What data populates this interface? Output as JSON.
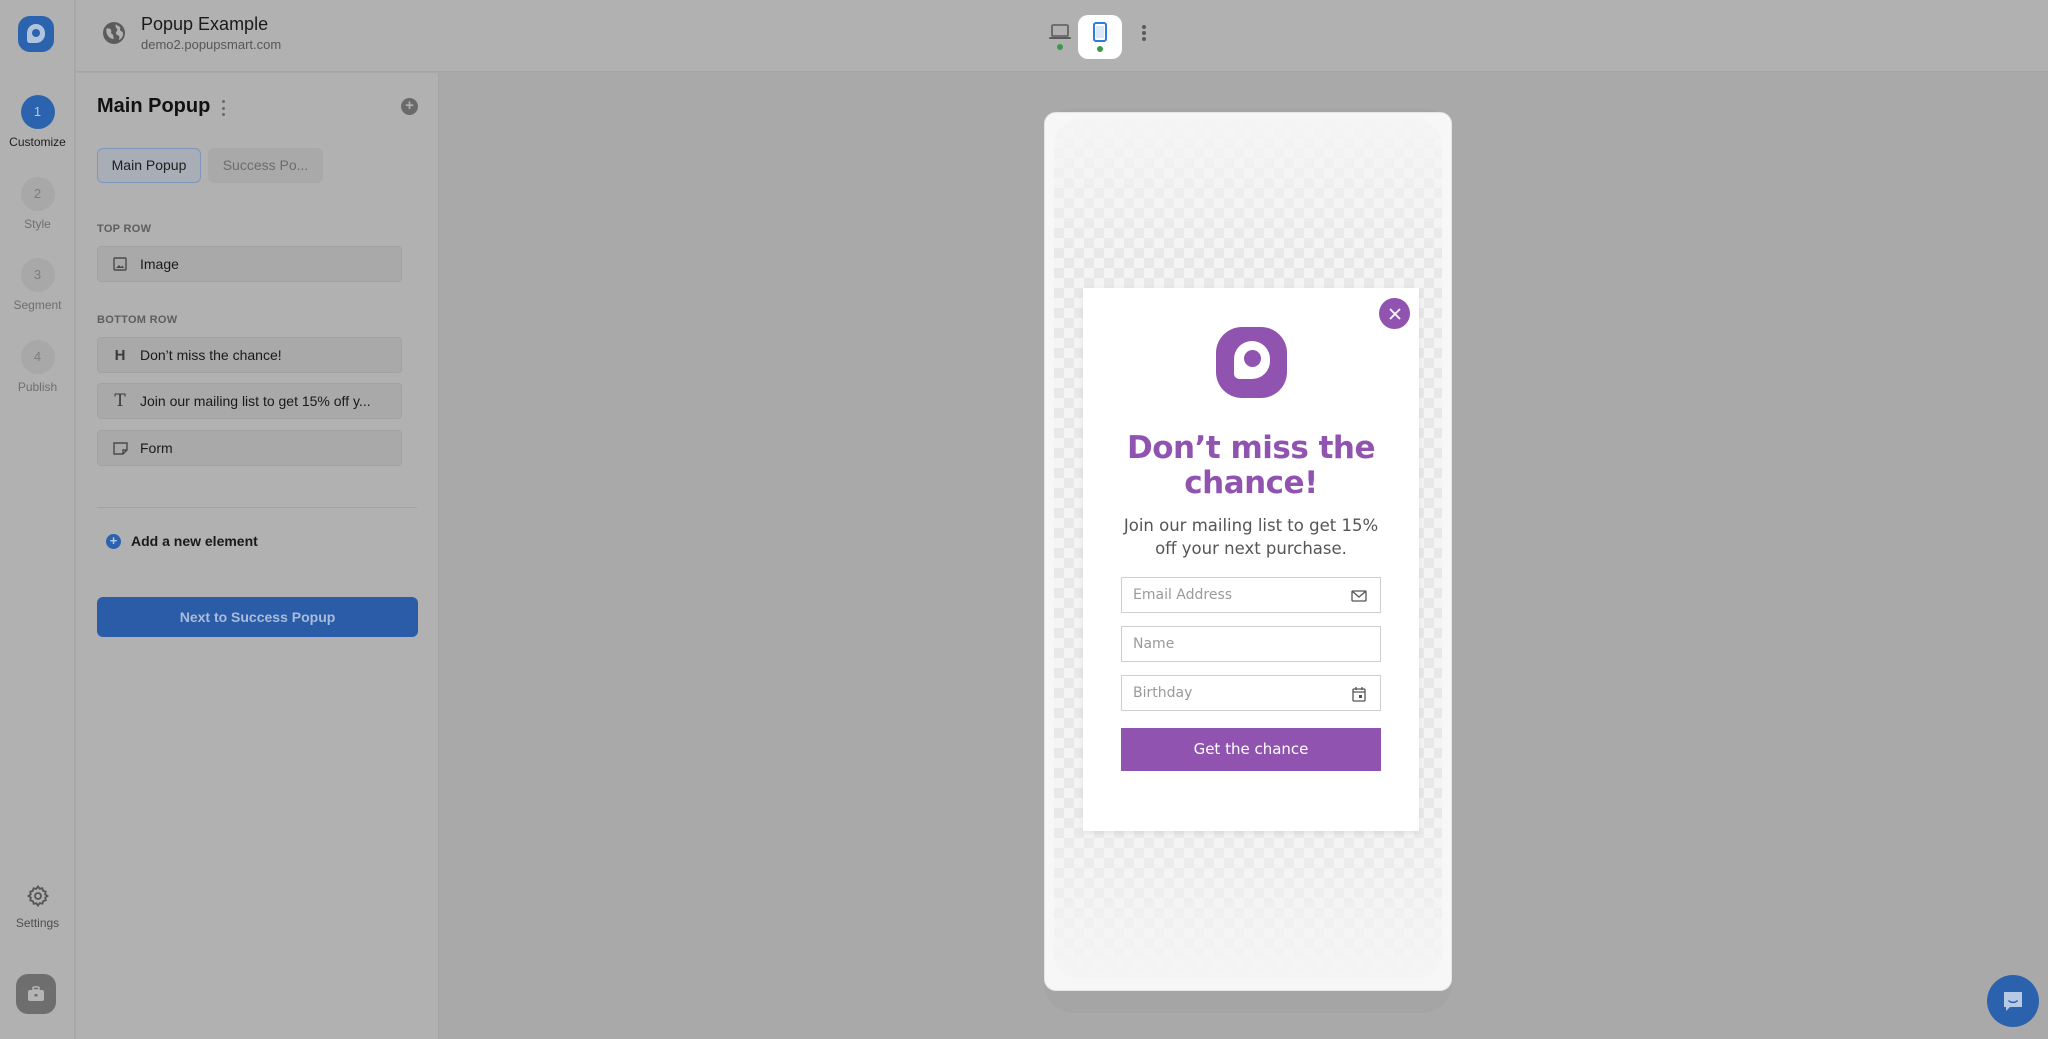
{
  "app": {
    "site_title": "Popup Example",
    "site_url": "demo2.popupsmart.com"
  },
  "rail": {
    "steps": [
      {
        "number": "1",
        "label": "Customize",
        "active": true
      },
      {
        "number": "2",
        "label": "Style",
        "active": false
      },
      {
        "number": "3",
        "label": "Segment",
        "active": false
      },
      {
        "number": "4",
        "label": "Publish",
        "active": false
      }
    ],
    "settings_label": "Settings"
  },
  "devices": {
    "options": [
      "desktop",
      "mobile"
    ],
    "selected": "mobile",
    "status_color": "#3b9a4a"
  },
  "panel": {
    "title": "Main Popup",
    "tabs": [
      {
        "label": "Main Popup",
        "active": true
      },
      {
        "label": "Success Po...",
        "active": false
      }
    ],
    "sections": [
      {
        "label": "TOP ROW",
        "items": [
          {
            "icon": "image-icon",
            "label": "Image"
          }
        ]
      },
      {
        "label": "BOTTOM ROW",
        "items": [
          {
            "icon": "heading-icon",
            "label": "Don’t miss the chance!"
          },
          {
            "icon": "text-icon",
            "label": "Join our mailing list to get 15% off y..."
          },
          {
            "icon": "form-icon",
            "label": "Form"
          }
        ]
      }
    ],
    "add_element_label": "Add a new element",
    "next_button_label": "Next to Success Popup"
  },
  "popup": {
    "title": "Don’t miss the chance!",
    "description": "Join our mailing list to get 15% off your next purchase.",
    "fields": [
      {
        "placeholder": "Email Address",
        "icon": "mail-icon"
      },
      {
        "placeholder": "Name",
        "icon": ""
      },
      {
        "placeholder": "Birthday",
        "icon": "calendar-icon"
      }
    ],
    "button_label": "Get the chance",
    "accent_color": "#9054b0"
  },
  "colors": {
    "brand_blue": "#2c63ae"
  }
}
